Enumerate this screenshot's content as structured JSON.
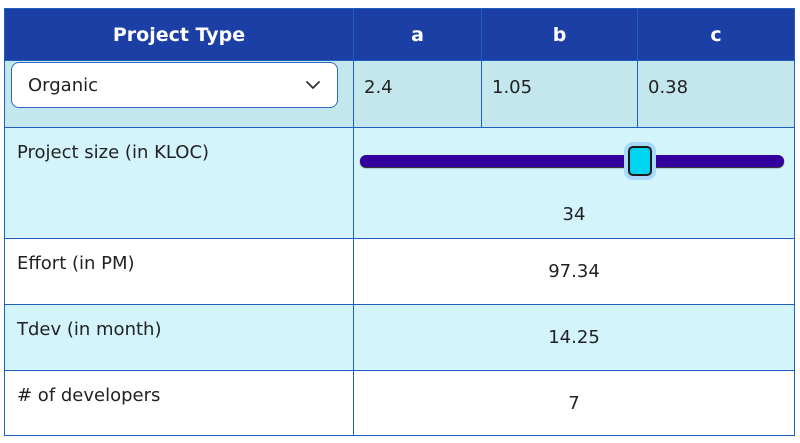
{
  "header": {
    "project_type": "Project Type",
    "a": "a",
    "b": "b",
    "c": "c"
  },
  "project_type_select": {
    "value": "Organic"
  },
  "coefficients": {
    "a": "2.4",
    "b": "1.05",
    "c": "0.38"
  },
  "project_size": {
    "label": "Project size (in KLOC)",
    "value": "34",
    "slider_fraction": 0.66
  },
  "effort": {
    "label": "Effort (in PM)",
    "value": "97.34"
  },
  "tdev": {
    "label": "Tdev (in month)",
    "value": "14.25"
  },
  "developers": {
    "label": "# of developers",
    "value": "7"
  },
  "colors": {
    "header_bg": "#1c3fa6",
    "row_teal": "#c3e7ec",
    "row_light": "#d3f4fb",
    "slider_track": "#33009e",
    "slider_thumb": "#00d4f0"
  },
  "icons": {
    "dropdown": "chevron-down-icon"
  }
}
